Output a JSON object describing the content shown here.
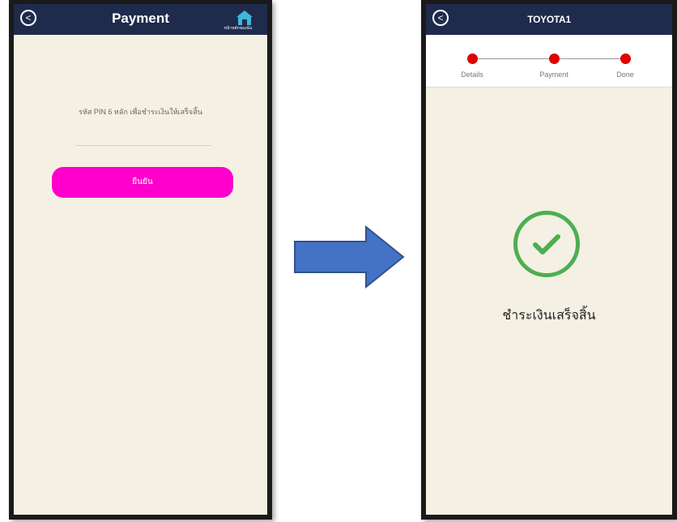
{
  "left_screen": {
    "title": "Payment",
    "home_caption": "หน้าหลักของฉัน",
    "pin_instruction": "รหัส PIN 6 หลัก เพื่อชำระเงินให้เสร็จสิ้น",
    "confirm_label": "ยืนยัน"
  },
  "right_screen": {
    "title": "TOYOTA1",
    "steps": [
      {
        "label": "Details"
      },
      {
        "label": "Payment"
      },
      {
        "label": "Done"
      }
    ],
    "success_message": "ชำระเงินเสร็จสิ้น"
  },
  "colors": {
    "header": "#1f2b4d",
    "background": "#f4f0e3",
    "confirm_button": "#ff00cc",
    "step_dot": "#e00000",
    "success": "#4caf50",
    "arrow": "#4472c4"
  },
  "icons": {
    "back": "back-circle-icon",
    "home": "home-icon",
    "success": "checkmark-circle-icon",
    "transition": "right-arrow-icon"
  }
}
